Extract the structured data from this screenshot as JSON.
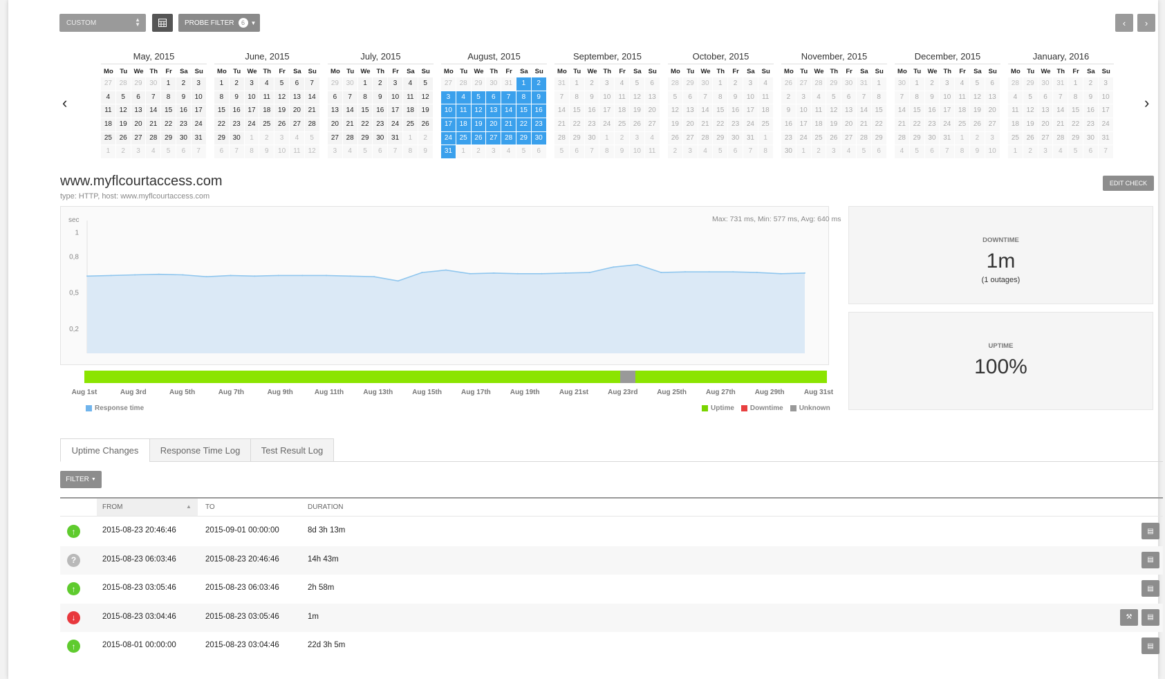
{
  "toolbar": {
    "range_select": "CUSTOM",
    "probe_filter_label": "PROBE FILTER",
    "probe_filter_count": "6",
    "prev_label": "‹",
    "next_label": "›"
  },
  "calendar": {
    "weekday_labels": [
      "Mo",
      "Tu",
      "We",
      "Th",
      "Fr",
      "Sa",
      "Su"
    ],
    "months": [
      {
        "title": "May, 2015",
        "first_prev": 27,
        "prev_len": 30,
        "start": 4,
        "len": 31,
        "sel_from": 0,
        "sel_to": 0,
        "past": true
      },
      {
        "title": "June, 2015",
        "first_prev": 0,
        "prev_len": 31,
        "start": 0,
        "len": 30,
        "sel_from": 0,
        "sel_to": 0,
        "past": true
      },
      {
        "title": "July, 2015",
        "first_prev": 29,
        "prev_len": 30,
        "start": 2,
        "len": 31,
        "sel_from": 0,
        "sel_to": 0,
        "past": true
      },
      {
        "title": "August, 2015",
        "first_prev": 27,
        "prev_len": 31,
        "start": 5,
        "len": 31,
        "sel_from": 1,
        "sel_to": 31,
        "past": true
      },
      {
        "title": "September, 2015",
        "first_prev": 31,
        "prev_len": 31,
        "start": 1,
        "len": 30,
        "sel_from": 0,
        "sel_to": 0,
        "past": false
      },
      {
        "title": "October, 2015",
        "first_prev": 28,
        "prev_len": 30,
        "start": 3,
        "len": 31,
        "sel_from": 0,
        "sel_to": 0,
        "past": false
      },
      {
        "title": "November, 2015",
        "first_prev": 26,
        "prev_len": 31,
        "start": 6,
        "len": 30,
        "sel_from": 0,
        "sel_to": 0,
        "past": false
      },
      {
        "title": "December, 2015",
        "first_prev": 30,
        "prev_len": 30,
        "start": 1,
        "len": 31,
        "sel_from": 0,
        "sel_to": 0,
        "past": false
      },
      {
        "title": "January, 2016",
        "first_prev": 28,
        "prev_len": 31,
        "start": 4,
        "len": 31,
        "sel_from": 0,
        "sel_to": 0,
        "past": false
      }
    ]
  },
  "check": {
    "title": "www.myflcourtaccess.com",
    "subtitle": "type: HTTP, host: www.myflcourtaccess.com",
    "edit_label": "EDIT CHECK"
  },
  "chart_data": {
    "type": "area",
    "ylabel": "sec",
    "yticks": [
      "1",
      "0,8",
      "0,5",
      "0,2"
    ],
    "ytick_values": [
      1.0,
      0.8,
      0.5,
      0.2
    ],
    "ylim": [
      0,
      1.1
    ],
    "stats": "Max: 731 ms, Min: 577 ms, Avg: 640 ms",
    "series": [
      {
        "name": "Response time",
        "color": "#8fc6ee",
        "values": [
          0.64,
          0.645,
          0.65,
          0.655,
          0.65,
          0.635,
          0.645,
          0.64,
          0.645,
          0.645,
          0.645,
          0.64,
          0.635,
          0.6,
          0.67,
          0.69,
          0.66,
          0.665,
          0.66,
          0.66,
          0.665,
          0.67,
          0.715,
          0.735,
          0.67,
          0.675,
          0.675,
          0.675,
          0.67,
          0.66,
          0.665
        ]
      }
    ],
    "xticks": [
      "Aug 1st",
      "Aug 3rd",
      "Aug 5th",
      "Aug 7th",
      "Aug 9th",
      "Aug 11th",
      "Aug 13th",
      "Aug 15th",
      "Aug 17th",
      "Aug 19th",
      "Aug 21st",
      "Aug 23rd",
      "Aug 25th",
      "Aug 27th",
      "Aug 29th",
      "Aug 31st"
    ],
    "status_bar": [
      {
        "status": "Uptime",
        "from": 0.0,
        "to": 0.722,
        "color": "#8be400"
      },
      {
        "status": "Unknown",
        "from": 0.722,
        "to": 0.742,
        "color": "#999999"
      },
      {
        "status": "Uptime",
        "from": 0.742,
        "to": 1.0,
        "color": "#8be400"
      }
    ],
    "legend_left": [
      {
        "name": "Response time",
        "color": "#70b4ec"
      }
    ],
    "legend_right": [
      {
        "name": "Uptime",
        "color": "#79d400"
      },
      {
        "name": "Downtime",
        "color": "#e84040"
      },
      {
        "name": "Unknown",
        "color": "#999999"
      }
    ]
  },
  "summary": {
    "downtime_label": "DOWNTIME",
    "downtime_value": "1m",
    "downtime_note": "(1 outages)",
    "uptime_label": "UPTIME",
    "uptime_value": "100%"
  },
  "tabs": [
    "Uptime Changes",
    "Response Time Log",
    "Test Result Log"
  ],
  "filter_label": "FILTER",
  "table": {
    "headers": {
      "from": "FROM",
      "to": "TO",
      "duration": "DURATION"
    },
    "rows": [
      {
        "status": "up",
        "from": "2015-08-23 20:46:46",
        "to": "2015-09-01 00:00:00",
        "duration": "8d 3h 13m"
      },
      {
        "status": "unknown",
        "from": "2015-08-23 06:03:46",
        "to": "2015-08-23 20:46:46",
        "duration": "14h 43m"
      },
      {
        "status": "up",
        "from": "2015-08-23 03:05:46",
        "to": "2015-08-23 06:03:46",
        "duration": "2h 58m"
      },
      {
        "status": "down",
        "from": "2015-08-23 03:04:46",
        "to": "2015-08-23 03:05:46",
        "duration": "1m"
      },
      {
        "status": "up",
        "from": "2015-08-01 00:00:00",
        "to": "2015-08-23 03:04:46",
        "duration": "22d 3h 5m"
      }
    ]
  },
  "colors": {
    "selected_day": "#3aa0ec",
    "up": "#5fcb2e",
    "down": "#e8383d",
    "unknown": "#b9b9b9"
  }
}
